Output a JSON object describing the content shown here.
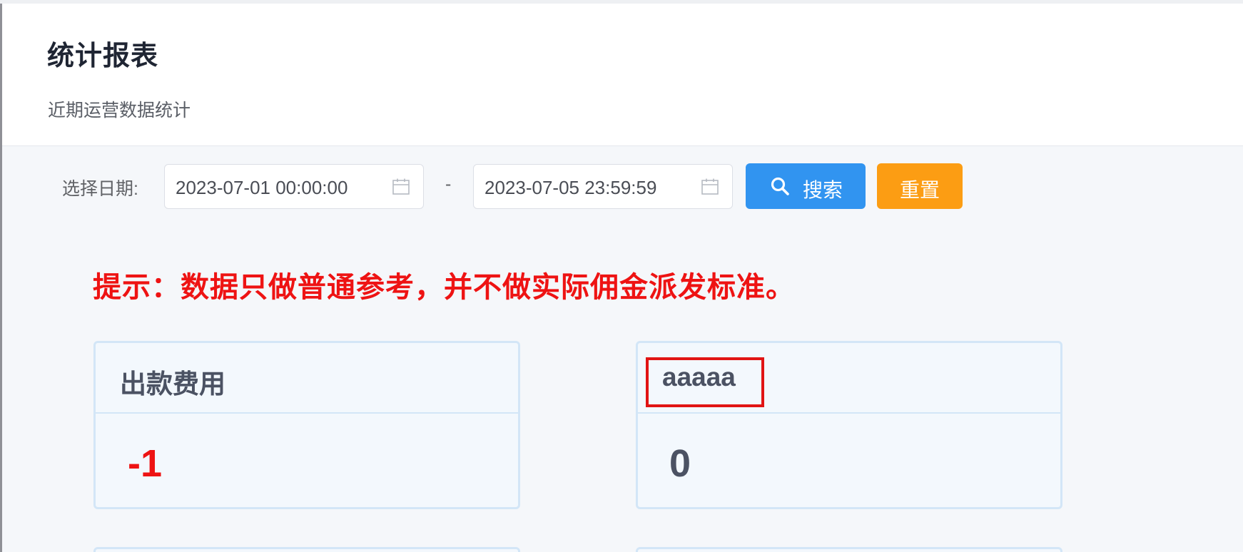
{
  "header": {
    "title": "统计报表",
    "subtitle": "近期运营数据统计"
  },
  "filter": {
    "label": "选择日期:",
    "start_value": "2023-07-01 00:00:00",
    "end_value": "2023-07-05 23:59:59",
    "separator": "-",
    "search_label": "搜索",
    "reset_label": "重置"
  },
  "notice": "提示：数据只做普通参考，并不做实际佣金派发标准。",
  "cards": [
    {
      "title": "出款费用",
      "value": "-1",
      "value_color": "#ee1313"
    },
    {
      "title": "aaaaa",
      "value": "0",
      "value_color": "#4b5263",
      "highlighted": true
    }
  ],
  "colors": {
    "primary": "#3194f0",
    "warning": "#fc9d13",
    "danger": "#ee1313",
    "highlight_border": "#e11414"
  },
  "icons": {
    "calendar": "calendar-icon",
    "search": "search-icon"
  }
}
